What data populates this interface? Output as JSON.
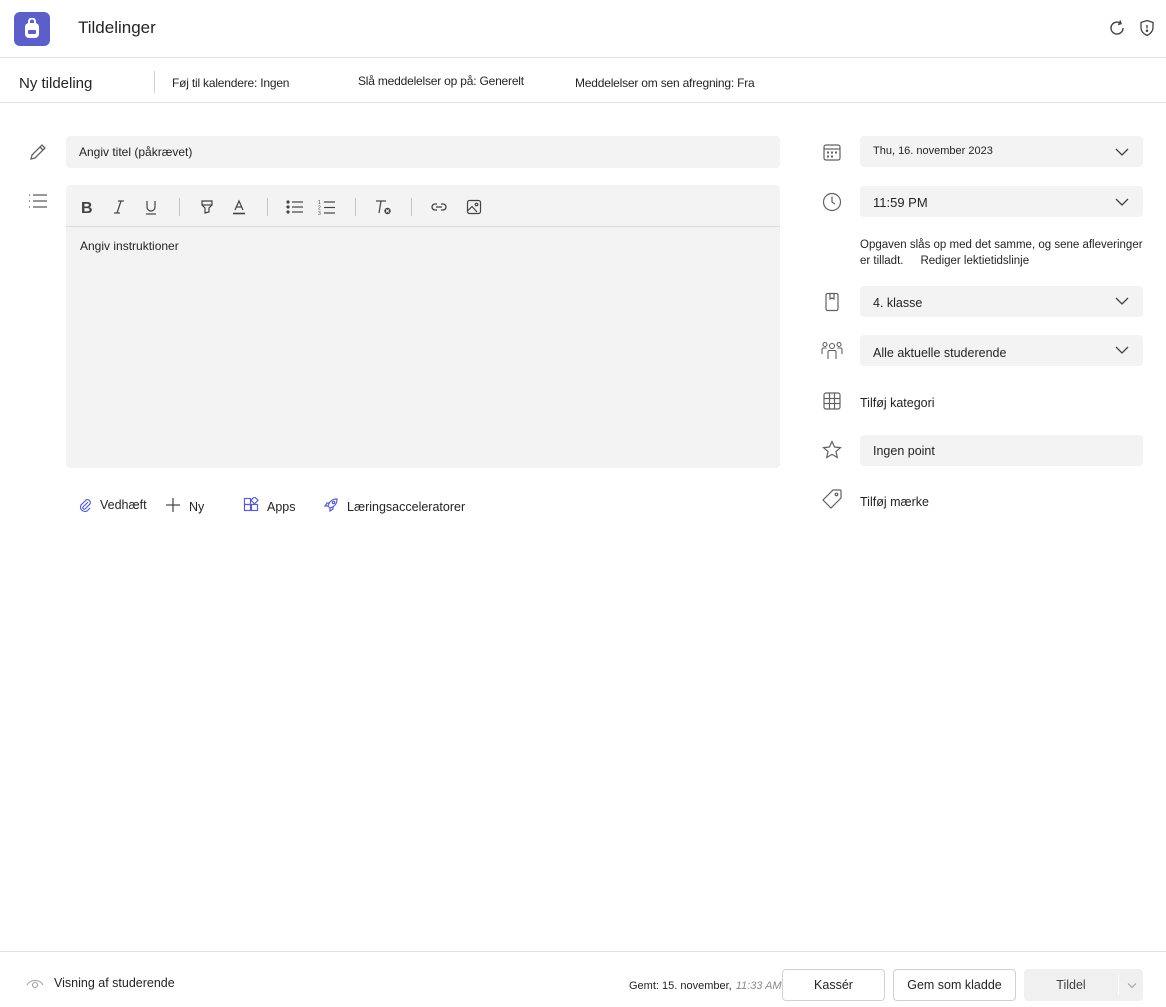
{
  "header": {
    "app_title": "Tildelinger",
    "icons": [
      "backpack-icon",
      "refresh-icon",
      "shield-icon"
    ],
    "brand_color": "#5b5fc7"
  },
  "subheader": {
    "title": "Ny tildeling",
    "calendar": "Føj til kalendere: Ingen",
    "notifications": "Slå meddelelser op på: Generelt",
    "late_notifications": "Meddelelser om sen afregning: Fra"
  },
  "form": {
    "title_placeholder": "Angiv titel (påkrævet)",
    "instructions_placeholder": "Angiv instruktioner",
    "toolbar": [
      "bold-icon",
      "italic-icon",
      "underline-icon",
      "highlight-icon",
      "font-color-icon",
      "bullet-list-icon",
      "numbered-list-icon",
      "clear-format-icon",
      "link-icon",
      "image-icon"
    ],
    "actions": {
      "attach": "Vedhæft",
      "new": "Ny",
      "apps": "Apps",
      "accelerators": "Læringsacceleratorer"
    }
  },
  "settings": {
    "due_date": "Thu, 16. november 2023",
    "due_time": "11:59 PM",
    "note": "Opgaven slås op med det samme, og sene afleveringer er tilladt.",
    "note_link": "Rediger lektietidslinje",
    "class": "4. klasse",
    "students": "Alle aktuelle studerende",
    "category": "Tilføj kategori",
    "points": "Ingen point",
    "tag": "Tilføj mærke"
  },
  "footer": {
    "preview": "Visning af studerende",
    "saved_label": "Gemt: 15. november,",
    "saved_time": "11:33 AM",
    "discard": "Kassér",
    "save_draft": "Gem som kladde",
    "assign": "Tildel"
  }
}
